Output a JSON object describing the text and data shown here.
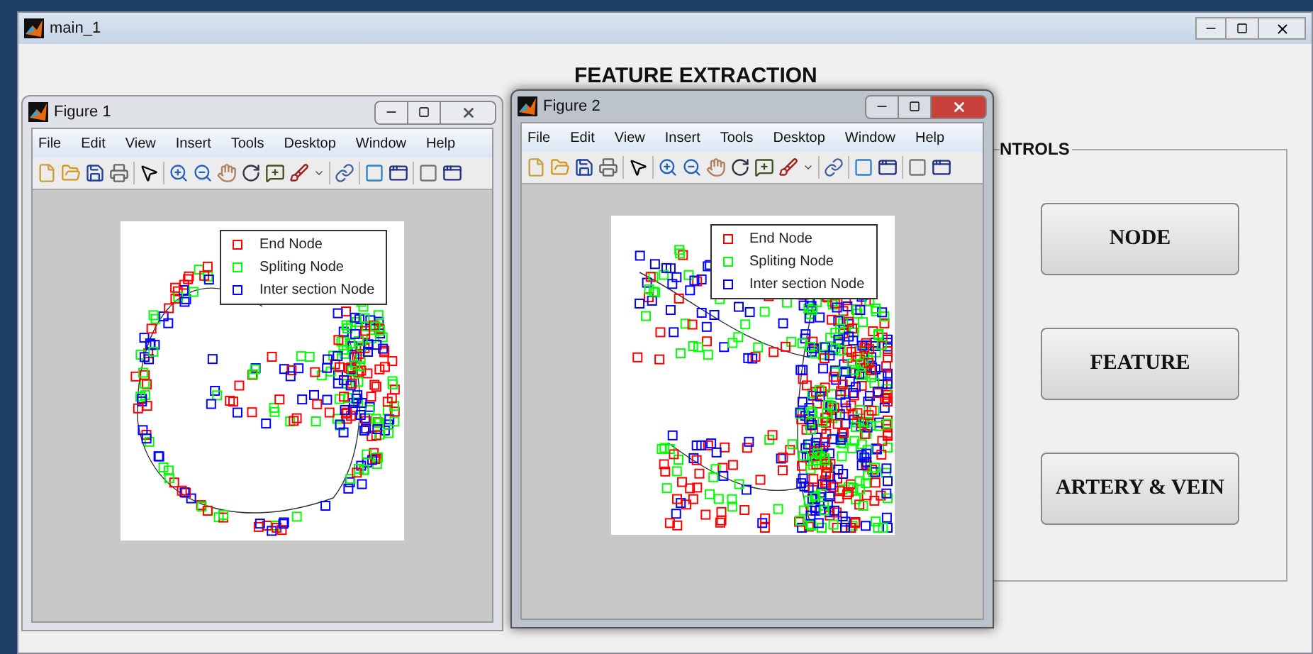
{
  "main_window": {
    "title": "main_1"
  },
  "heading": "FEATURE EXTRACTION",
  "controls": {
    "label": "NTROLS",
    "buttons": [
      "NODE",
      "FEATURE",
      "ARTERY & VEIN"
    ]
  },
  "figures": [
    {
      "title": "Figure 1",
      "active": false,
      "menu": [
        "File",
        "Edit",
        "View",
        "Insert",
        "Tools",
        "Desktop",
        "Window",
        "Help"
      ],
      "legend": [
        {
          "label": "End Node",
          "color": "#ff0000"
        },
        {
          "label": "Spliting Node",
          "color": "#00ff00"
        },
        {
          "label": "Inter section Node",
          "color": "#0000ff"
        }
      ]
    },
    {
      "title": "Figure 2",
      "active": true,
      "menu": [
        "File",
        "Edit",
        "View",
        "Insert",
        "Tools",
        "Desktop",
        "Window",
        "Help"
      ],
      "legend": [
        {
          "label": "End Node",
          "color": "#ff0000"
        },
        {
          "label": "Spliting Node",
          "color": "#00ff00"
        },
        {
          "label": "Inter section Node",
          "color": "#0000ff"
        }
      ]
    }
  ]
}
